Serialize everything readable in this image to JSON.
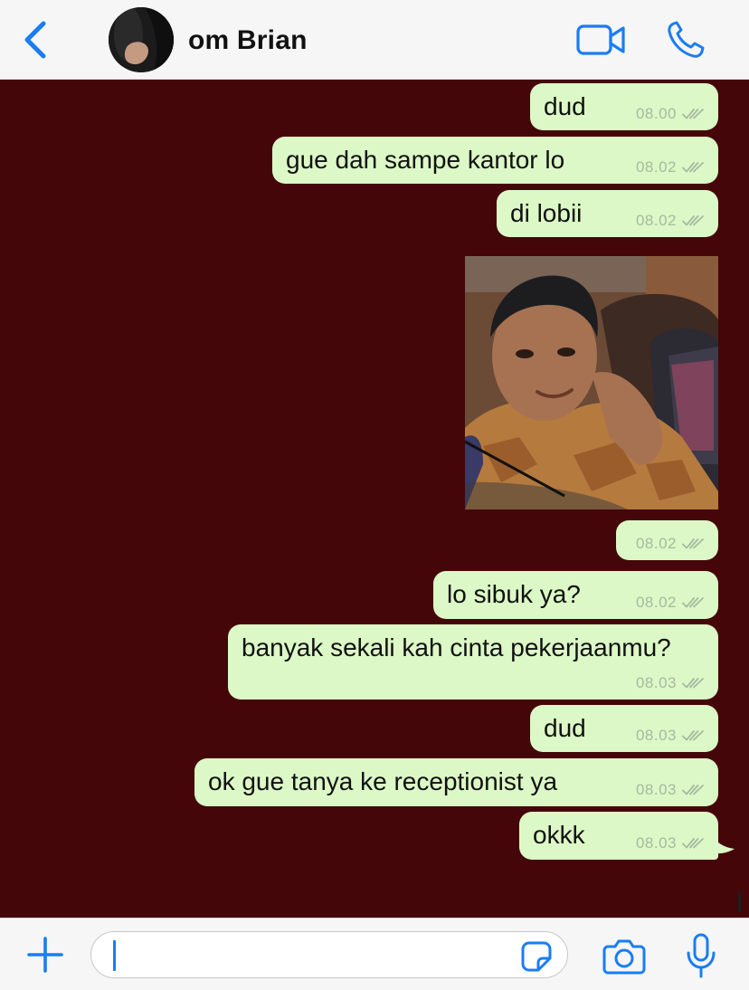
{
  "header": {
    "back_icon": "chevron-left-icon",
    "contact_name": "om Brian",
    "video_icon": "video-camera-icon",
    "call_icon": "phone-icon"
  },
  "messages": [
    {
      "text": "dud",
      "time": "08.00",
      "status": "read"
    },
    {
      "text": "gue dah sampe kantor lo",
      "time": "08.02",
      "status": "read"
    },
    {
      "text": "di lobii",
      "time": "08.02",
      "status": "read"
    },
    {
      "type": "image",
      "time": "08.02",
      "status": "read"
    },
    {
      "text": "lo sibuk ya?",
      "time": "08.02",
      "status": "read"
    },
    {
      "text": "banyak sekali kah cinta pekerjaanmu?",
      "time": "08.03",
      "status": "read"
    },
    {
      "text": "dud",
      "time": "08.03",
      "status": "read"
    },
    {
      "text": "ok gue tanya ke receptionist ya",
      "time": "08.03",
      "status": "read"
    },
    {
      "text": "okkk",
      "time": "08.03",
      "status": "read"
    }
  ],
  "input": {
    "value": "",
    "plus_icon": "plus-icon",
    "sticker_icon": "sticker-icon",
    "camera_icon": "camera-icon",
    "mic_icon": "microphone-icon"
  },
  "colors": {
    "accent": "#1a7df2",
    "chat_background": "#450609",
    "outgoing_bubble": "#dcf8c6",
    "time_text": "#a8b9a1"
  }
}
